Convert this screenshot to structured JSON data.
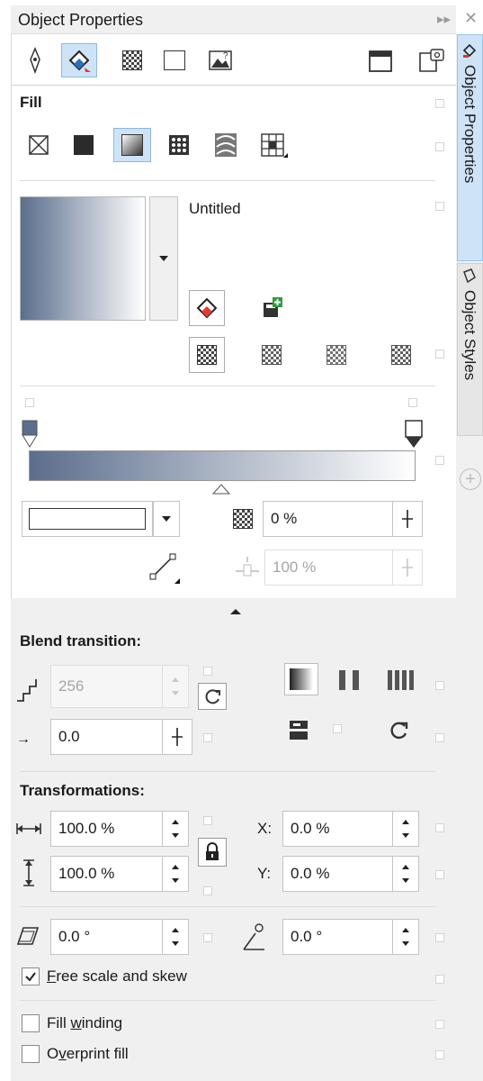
{
  "window": {
    "title": "Object Properties"
  },
  "dock_tabs": [
    {
      "label": "Object Properties",
      "active": true
    },
    {
      "label": "Object Styles",
      "active": false
    }
  ],
  "toolbar": {
    "icons": [
      "outline-pen-icon",
      "fill-icon",
      "transparency-icon",
      "frame-icon",
      "bitmap-icon",
      "frames-icon",
      "summary-icon"
    ]
  },
  "fill": {
    "header": "Fill",
    "types": [
      "no-fill",
      "uniform-fill",
      "fountain-fill",
      "vector-pattern-fill",
      "bitmap-pattern-fill",
      "two-color-pattern-fill"
    ],
    "selected_type": "fountain-fill",
    "preset_name": "Untitled",
    "gradient_start": "#5b6e8c",
    "gradient_end": "#ffffff"
  },
  "gradient": {
    "node_color_label": "",
    "transparency_value": "0 %",
    "position_value": "100 %"
  },
  "blend": {
    "header": "Blend transition:",
    "steps": "256",
    "acceleration": "0.0"
  },
  "transformations": {
    "header": "Transformations:",
    "width": "100.0 %",
    "height": "100.0 %",
    "x_label": "X:",
    "x_value": "0.0 %",
    "y_label": "Y:",
    "y_value": "0.0 %",
    "skew": "0.0 °",
    "rotation": "0.0 °"
  },
  "options": {
    "free_scale_pre": "",
    "free_scale_u": "F",
    "free_scale_post": "ree scale and skew",
    "free_scale_checked": true,
    "fill_winding_pre": "Fill ",
    "fill_winding_u": "w",
    "fill_winding_post": "inding",
    "fill_winding_checked": false,
    "overprint_pre": "O",
    "overprint_u": "v",
    "overprint_post": "erprint fill",
    "overprint_checked": false
  },
  "colors": {
    "accent": "#cfe3f7",
    "gradient_dark": "#5b6e8c",
    "panel_gray": "#f0f0f0"
  }
}
